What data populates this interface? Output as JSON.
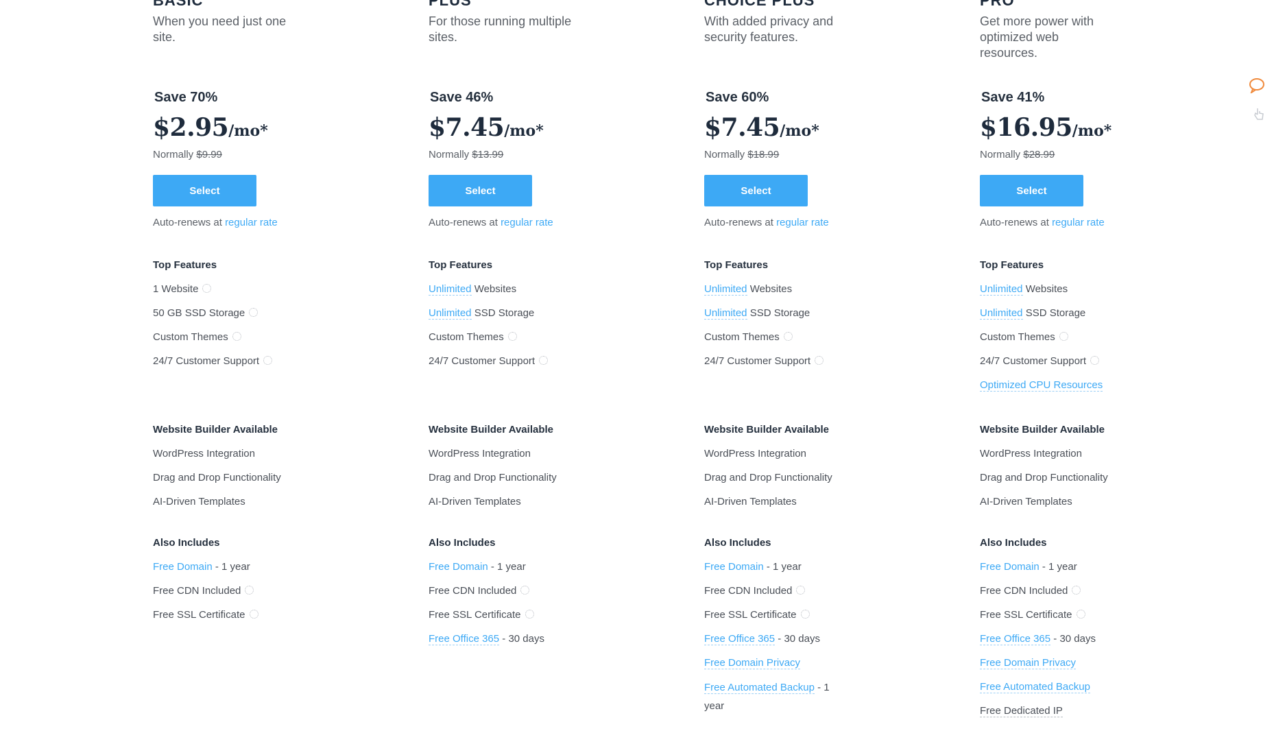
{
  "plans": [
    {
      "name": "BASIC",
      "tagline": "When you need just one site.",
      "save": "Save 70%",
      "price": "$2.95",
      "price_unit": "/mo*",
      "normally_label": "Normally",
      "normal_price": "$9.99",
      "select_label": "Select",
      "auto_renew_prefix": "Auto-renews at",
      "auto_renew_link": "regular rate",
      "top_features_heading": "Top Features",
      "website_builder_heading": "Website Builder Available",
      "also_includes_heading": "Also Includes"
    },
    {
      "name": "PLUS",
      "tagline": "For those running multiple sites.",
      "save": "Save 46%",
      "price": "$7.45",
      "price_unit": "/mo*",
      "normally_label": "Normally",
      "normal_price": "$13.99",
      "select_label": "Select",
      "auto_renew_prefix": "Auto-renews at",
      "auto_renew_link": "regular rate",
      "top_features_heading": "Top Features",
      "website_builder_heading": "Website Builder Available",
      "also_includes_heading": "Also Includes"
    },
    {
      "name": "CHOICE PLUS",
      "tagline": "With added privacy and security features.",
      "save": "Save 60%",
      "price": "$7.45",
      "price_unit": "/mo*",
      "normally_label": "Normally",
      "normal_price": "$18.99",
      "select_label": "Select",
      "auto_renew_prefix": "Auto-renews at",
      "auto_renew_link": "regular rate",
      "top_features_heading": "Top Features",
      "website_builder_heading": "Website Builder Available",
      "also_includes_heading": "Also Includes"
    },
    {
      "name": "PRO",
      "tagline": "Get more power with optimized web resources.",
      "save": "Save 41%",
      "price": "$16.95",
      "price_unit": "/mo*",
      "normally_label": "Normally",
      "normal_price": "$28.99",
      "select_label": "Select",
      "auto_renew_prefix": "Auto-renews at",
      "auto_renew_link": "regular rate",
      "top_features_heading": "Top Features",
      "website_builder_heading": "Website Builder Available",
      "also_includes_heading": "Also Includes"
    }
  ],
  "features": {
    "basic_top": [
      "1 Website",
      "50 GB SSD Storage",
      "Custom Themes",
      "24/7 Customer Support"
    ],
    "unlimited": "Unlimited",
    "websites": "Websites",
    "ssd_storage": "SSD Storage",
    "custom_themes": "Custom Themes",
    "support": "24/7 Customer Support",
    "optimized_cpu": "Optimized CPU Resources",
    "builder": [
      "WordPress Integration",
      "Drag and Drop Functionality",
      "AI-Driven Templates"
    ],
    "free_domain": "Free Domain",
    "free_domain_suffix": "- 1 year",
    "free_cdn": "Free CDN Included",
    "free_ssl": "Free SSL Certificate",
    "free_office": "Free Office 365",
    "free_office_suffix": "- 30 days",
    "free_domain_privacy": "Free Domain Privacy",
    "free_backup": "Free Automated Backup",
    "free_backup_suffix": "- 1 year",
    "free_dedicated_ip": "Free Dedicated IP"
  },
  "side_icons": [
    "chat-icon",
    "hand-pointer-icon"
  ],
  "colors": {
    "accent": "#3da9f5",
    "heading": "#1e2b3c",
    "text": "#4a4f57"
  }
}
